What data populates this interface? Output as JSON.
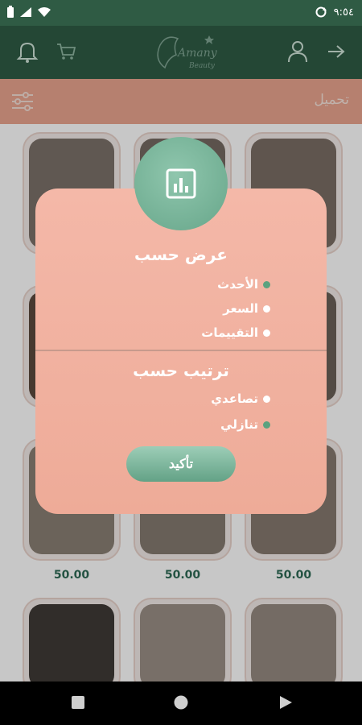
{
  "status_bar": {
    "time": "٩:٥٤"
  },
  "app_bar": {
    "logo_text": "Amany Beauty"
  },
  "filter_bar": {
    "search_label": "تحميل"
  },
  "products": {
    "prices": [
      "50.00",
      "50.00",
      "50.00"
    ]
  },
  "dialog": {
    "view_by_title": "عرض حسب",
    "view_options": [
      {
        "label": "الأحدث",
        "selected": true
      },
      {
        "label": "السعر",
        "selected": false
      },
      {
        "label": "التقييمات",
        "selected": false
      }
    ],
    "sort_by_title": "ترتيب حسب",
    "sort_options": [
      {
        "label": "تصاعدي",
        "selected": false
      },
      {
        "label": "تنازلي",
        "selected": true
      }
    ],
    "confirm_label": "تأكيد"
  },
  "colors": {
    "primary_green": "#2f5b44",
    "salmon": "#e9a48f",
    "accent_green": "#5aa27f"
  }
}
